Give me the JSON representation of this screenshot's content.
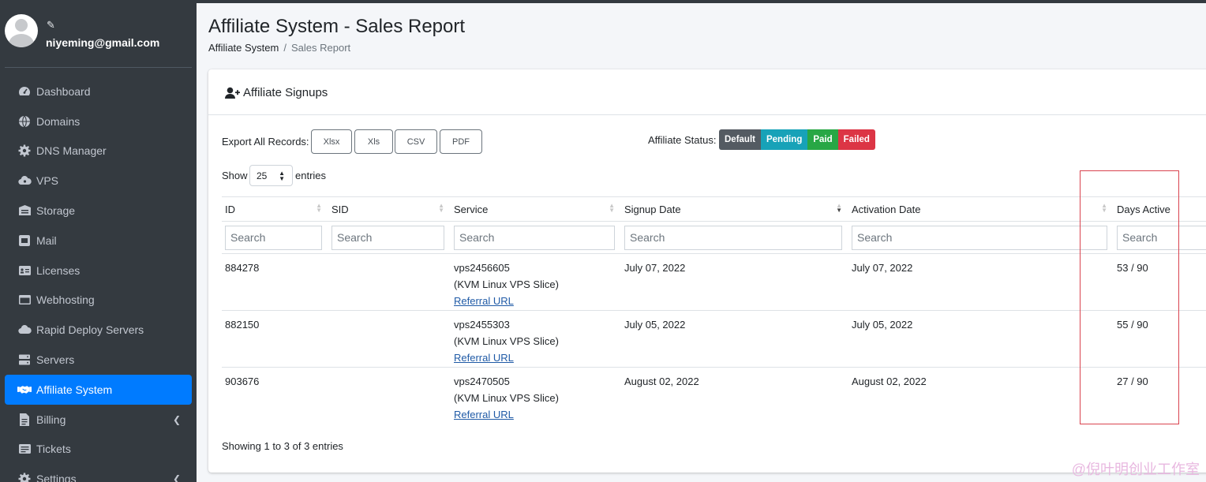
{
  "user": {
    "email": "niyeming@gmail.com"
  },
  "sidebar": {
    "items": [
      {
        "label": "Dashboard",
        "icon": "dashboard-icon"
      },
      {
        "label": "Domains",
        "icon": "globe-icon"
      },
      {
        "label": "DNS Manager",
        "icon": "cog-icon"
      },
      {
        "label": "VPS",
        "icon": "cloud-icon"
      },
      {
        "label": "Storage",
        "icon": "storage-icon"
      },
      {
        "label": "Mail",
        "icon": "mail-icon"
      },
      {
        "label": "Licenses",
        "icon": "license-icon"
      },
      {
        "label": "Webhosting",
        "icon": "window-icon"
      },
      {
        "label": "Rapid Deploy Servers",
        "icon": "cloud-icon"
      },
      {
        "label": "Servers",
        "icon": "server-icon"
      },
      {
        "label": "Affiliate System",
        "icon": "handshake-icon",
        "active": true
      },
      {
        "label": "Billing",
        "icon": "file-icon",
        "has_children": true
      },
      {
        "label": "Tickets",
        "icon": "ticket-icon"
      },
      {
        "label": "Settings",
        "icon": "gear-icon",
        "has_children": true
      }
    ]
  },
  "page": {
    "title": "Affiliate System - Sales Report",
    "breadcrumb": [
      "Affiliate System",
      "Sales Report"
    ],
    "card_title": "Affiliate Signups"
  },
  "export": {
    "label": "Export All Records:",
    "buttons": [
      "Xlsx",
      "Xls",
      "CSV",
      "PDF"
    ]
  },
  "status": {
    "label": "Affiliate Status:",
    "items": [
      {
        "label": "Default",
        "color": "#545b62"
      },
      {
        "label": "Pending",
        "color": "#17a2b8"
      },
      {
        "label": "Paid",
        "color": "#28a745"
      },
      {
        "label": "Failed",
        "color": "#dc3545"
      }
    ]
  },
  "length": {
    "show": "Show",
    "value": "25",
    "entries": "entries"
  },
  "table": {
    "columns": [
      "ID",
      "SID",
      "Service",
      "Signup Date",
      "Activation Date",
      "Days Active"
    ],
    "search_placeholder": "Search",
    "rows": [
      {
        "id": "884278",
        "sid": "",
        "service": "vps2456605",
        "service_type": "(KVM Linux VPS Slice)",
        "link": "Referral URL",
        "signup": "July 07, 2022",
        "activation": "July 07, 2022",
        "days": "53 / 90"
      },
      {
        "id": "882150",
        "sid": "",
        "service": "vps2455303",
        "service_type": "(KVM Linux VPS Slice)",
        "link": "Referral URL",
        "signup": "July 05, 2022",
        "activation": "July 05, 2022",
        "days": "55 / 90"
      },
      {
        "id": "903676",
        "sid": "",
        "service": "vps2470505",
        "service_type": "(KVM Linux VPS Slice)",
        "link": "Referral URL",
        "signup": "August 02, 2022",
        "activation": "August 02, 2022",
        "days": "27 / 90"
      }
    ]
  },
  "info": "Showing 1 to 3 of 3 entries",
  "watermark": "@倪叶明创业工作室"
}
